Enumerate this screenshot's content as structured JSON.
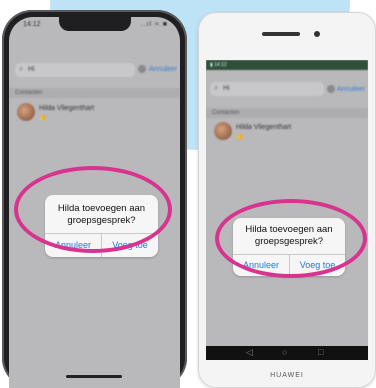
{
  "iphone": {
    "status_time": "14:12",
    "status_icons": "..ıl ≈ ■",
    "search": {
      "icon": "search-icon",
      "text": "Hi"
    },
    "cancel_label": "Annuleer",
    "section_label": "Contacten",
    "contact": {
      "name": "Hilda Vliegenthart",
      "emoji": "👍"
    },
    "alert": {
      "title": "Hilda toevoegen aan groepsgesprek?",
      "cancel": "Annuleer",
      "confirm": "Voeg toe"
    }
  },
  "huawei": {
    "status_text": "▮ 14:12",
    "search": {
      "icon": "search-icon",
      "text": "Hi"
    },
    "cancel_label": "Annuleer",
    "section_label": "Contacten",
    "contact": {
      "name": "Hilda Vliegenthart",
      "emoji": "👍"
    },
    "alert": {
      "title": "Hilda toevoegen aan groepsgesprek?",
      "cancel": "Annuleer",
      "confirm": "Voeg toe"
    },
    "nav": {
      "back": "◁",
      "home": "○",
      "recents": "□"
    },
    "brand": "HUAWEI"
  },
  "colors": {
    "highlight": "#d7338f",
    "link": "#1e7ae0",
    "backdrop": "#bfe3f6"
  }
}
